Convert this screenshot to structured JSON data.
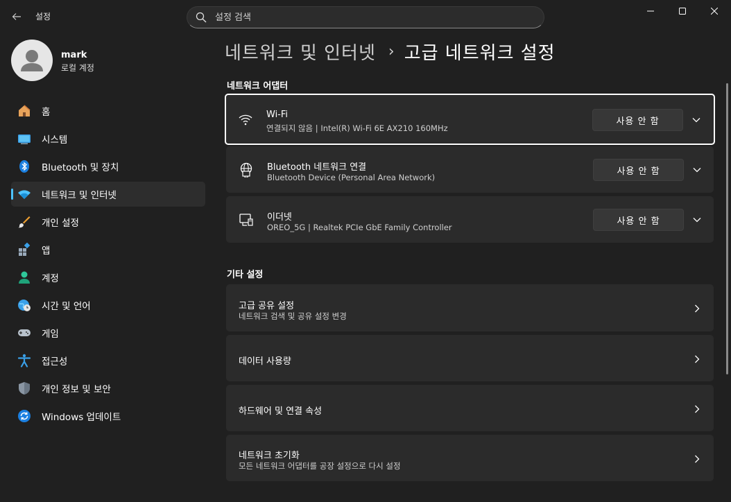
{
  "window": {
    "title": "설정",
    "search_placeholder": "설정 검색"
  },
  "profile": {
    "name": "mark",
    "account_type": "로컬 계정"
  },
  "sidebar": {
    "items": [
      {
        "label": "홈",
        "icon": "home-icon"
      },
      {
        "label": "시스템",
        "icon": "system-icon"
      },
      {
        "label": "Bluetooth 및 장치",
        "icon": "bluetooth-icon"
      },
      {
        "label": "네트워크 및 인터넷",
        "icon": "wifi-icon",
        "active": true
      },
      {
        "label": "개인 설정",
        "icon": "brush-icon"
      },
      {
        "label": "앱",
        "icon": "apps-icon"
      },
      {
        "label": "계정",
        "icon": "account-icon"
      },
      {
        "label": "시간 및 언어",
        "icon": "globe-clock-icon"
      },
      {
        "label": "게임",
        "icon": "gamepad-icon"
      },
      {
        "label": "접근성",
        "icon": "accessibility-icon"
      },
      {
        "label": "개인 정보 및 보안",
        "icon": "shield-icon"
      },
      {
        "label": "Windows 업데이트",
        "icon": "update-icon"
      }
    ]
  },
  "breadcrumb": {
    "parent": "네트워크 및 인터넷",
    "separator": "›",
    "current": "고급 네트워크 설정"
  },
  "adapters": {
    "section_title": "네트워크 어댑터",
    "items": [
      {
        "title": "Wi-Fi",
        "subtitle": "연결되지 않음 | Intel(R) Wi-Fi 6E AX210 160MHz",
        "button": "사용 안 함",
        "icon": "wifi-icon"
      },
      {
        "title": "Bluetooth 네트워크 연결",
        "subtitle": "Bluetooth Device (Personal Area Network)",
        "button": "사용 안 함",
        "icon": "network-globe-icon"
      },
      {
        "title": "이더넷",
        "subtitle": "OREO_5G | Realtek PCIe GbE Family Controller",
        "button": "사용 안 함",
        "icon": "ethernet-icon"
      }
    ]
  },
  "other": {
    "section_title": "기타 설정",
    "items": [
      {
        "title": "고급 공유 설정",
        "subtitle": "네트워크 검색 및 공유 설정 변경"
      },
      {
        "title": "데이터 사용량",
        "subtitle": ""
      },
      {
        "title": "하드웨어 및 연결 속성",
        "subtitle": ""
      },
      {
        "title": "네트워크 초기화",
        "subtitle": "모든 네트워크 어댑터를 공장 설정으로 다시 설정"
      }
    ]
  },
  "colors": {
    "accent": "#4cc2ff",
    "background": "#202020",
    "card": "#2b2b2b"
  }
}
